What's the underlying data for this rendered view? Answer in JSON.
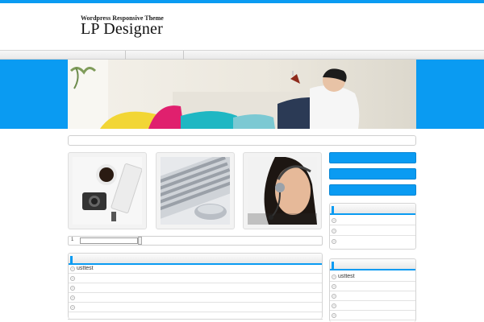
{
  "header": {
    "tagline": "Wordpress Responsive Theme",
    "logo": "LP Designer"
  },
  "nav": {
    "items": [
      "",
      "",
      ""
    ]
  },
  "pager": {
    "marker": "1"
  },
  "main_list": {
    "heading": "",
    "items": [
      "usttest",
      "",
      "",
      "",
      ""
    ]
  },
  "sidebar": {
    "buttons": [
      "",
      "",
      ""
    ],
    "widget_1": {
      "heading": "",
      "items": [
        "",
        "",
        ""
      ]
    },
    "widget_2": {
      "heading": "",
      "items": [
        "usttest",
        "",
        "",
        "",
        ""
      ]
    }
  },
  "colors": {
    "accent": "#0a9bf2"
  }
}
